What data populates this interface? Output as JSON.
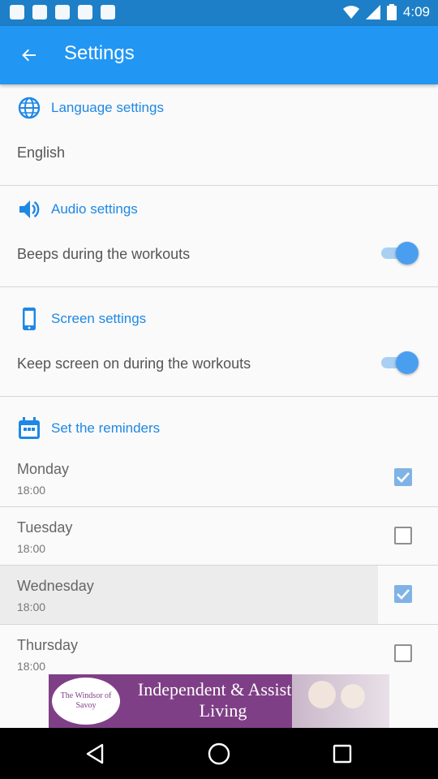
{
  "status_bar": {
    "time": "4:09"
  },
  "app_bar": {
    "title": "Settings"
  },
  "sections": {
    "language": {
      "header": "Language settings",
      "value": "English"
    },
    "audio": {
      "header": "Audio settings",
      "beeps_label": "Beeps during the workouts",
      "beeps_on": true
    },
    "screen": {
      "header": "Screen settings",
      "keep_on_label": "Keep screen on during the workouts",
      "keep_on": true
    },
    "reminders": {
      "header": "Set the reminders",
      "days": [
        {
          "name": "Monday",
          "time": "18:00",
          "checked": true
        },
        {
          "name": "Tuesday",
          "time": "18:00",
          "checked": false
        },
        {
          "name": "Wednesday",
          "time": "18:00",
          "checked": true
        },
        {
          "name": "Thursday",
          "time": "18:00",
          "checked": false
        }
      ]
    }
  },
  "ad": {
    "logo_text": "The Windsor of Savoy",
    "headline": "Independent & Assisted Living"
  },
  "icons": {
    "back": "arrow-left-icon",
    "language": "globe-icon",
    "audio": "speaker-icon",
    "screen": "phone-icon",
    "reminders": "calendar-icon"
  },
  "colors": {
    "app_bar": "#2196f3",
    "status_bar": "#1d7fc7",
    "accent": "#1e88e5",
    "checked": "#7fb3e6"
  }
}
